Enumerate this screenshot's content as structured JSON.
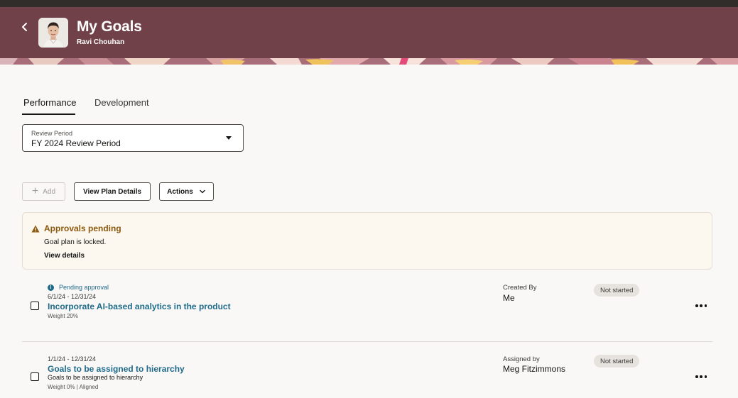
{
  "header": {
    "title": "My Goals",
    "user_name": "Ravi Chouhan",
    "back_icon": "chevron-left-icon",
    "colors": {
      "header_bg": "#714149",
      "top_bar": "#312d2a"
    }
  },
  "tabs": [
    {
      "label": "Performance",
      "active": true
    },
    {
      "label": "Development",
      "active": false
    }
  ],
  "review_period": {
    "label": "Review Period",
    "value": "FY 2024 Review Period"
  },
  "toolbar": {
    "add_label": "Add",
    "view_plan_label": "View Plan Details",
    "actions_label": "Actions"
  },
  "message": {
    "icon": "warning-icon",
    "title": "Approvals pending",
    "text": "Goal plan is locked.",
    "link": "View details"
  },
  "goals": [
    {
      "pending_label": "Pending approval",
      "dates": "6/1/24 - 12/31/24",
      "title": "Incorporate AI-based analytics in the product",
      "description": "",
      "meta": "Weight 20%",
      "by_label": "Created By",
      "by_value": "Me",
      "status": "Not started"
    },
    {
      "pending_label": "",
      "dates": "1/1/24 - 12/31/24",
      "title": "Goals to be assigned to hierarchy",
      "description": "Goals to be assigned to hierarchy",
      "meta": "Weight 0% | Aligned",
      "by_label": "Assigned by",
      "by_value": "Meg Fitzimmons",
      "status": "Not started"
    }
  ]
}
